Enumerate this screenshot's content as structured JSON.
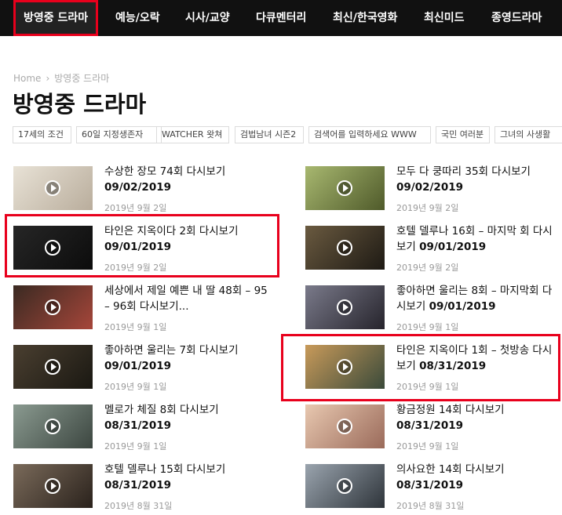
{
  "nav": {
    "items": [
      {
        "label": "방영중 드라마",
        "active": true
      },
      {
        "label": "예능/오락"
      },
      {
        "label": "시사/교양"
      },
      {
        "label": "다큐멘터리"
      },
      {
        "label": "최신/한국영화"
      },
      {
        "label": "최신미드"
      },
      {
        "label": "종영드라마"
      }
    ]
  },
  "breadcrumb": {
    "home": "Home",
    "separator": "›",
    "current": "방영중 드라마"
  },
  "page_title": "방영중 드라마",
  "tags": [
    "17세의 조건",
    "60일 지정생존자",
    "WATCHER 왓쳐",
    "검법남녀 시즌2",
    "검색어를 입력하세요 WWW",
    "국민 여러분",
    "그녀의 사생활"
  ],
  "colors": {
    "nav_bg": "#111111",
    "highlight": "#e8001c",
    "meta": "#999999"
  },
  "posts": [
    {
      "title": "수상한 장모 74회 다시보기",
      "date": "09/02/2019",
      "meta": "2019년 9월 2일",
      "thumb": "#c9c2b8",
      "icon": "play-icon"
    },
    {
      "title": "모두 다 쿵따리 35회 다시보기",
      "date": "09/02/2019",
      "meta": "2019년 9월 2일",
      "thumb": "#7d8a52",
      "icon": "play-icon"
    },
    {
      "title": "타인은 지옥이다 2회 다시보기",
      "date": "09/01/2019",
      "meta": "2019년 9월 2일",
      "thumb": "#141414",
      "icon": "play-icon"
    },
    {
      "title": "호텔 델루나 16회 – 마지막 회 다시보기",
      "date": "09/01/2019",
      "meta": "2019년 9월 2일",
      "thumb": "#3a3024",
      "icon": "play-icon"
    },
    {
      "title": "세상에서 제일 예쁜 내 딸 48회 – 95 – 96회 다시보기...",
      "date": "",
      "meta": "2019년 9월 1일",
      "thumb": "#8a3a2a",
      "icon": "play-icon"
    },
    {
      "title": "좋아하면 울리는 8회 – 마지막회 다시보기",
      "date": "09/01/2019",
      "meta": "2019년 9월 1일",
      "thumb": "#4b4a56",
      "icon": "play-icon"
    },
    {
      "title": "좋아하면 울리는 7회 다시보기",
      "date": "09/01/2019",
      "meta": "2019년 9월 1일",
      "thumb": "#2e2a24",
      "icon": "play-icon"
    },
    {
      "title": "타인은 지옥이다 1회 – 첫방송 다시보기",
      "date": "08/31/2019",
      "meta": "2019년 9월 1일",
      "thumb": "#6f5a3c",
      "icon": "play-icon"
    },
    {
      "title": "멜로가 체질 8회 다시보기",
      "date": "08/31/2019",
      "meta": "2019년 9월 1일",
      "thumb": "#5e6a62",
      "icon": "play-icon"
    },
    {
      "title": "황금정원 14회 다시보기",
      "date": "08/31/2019",
      "meta": "2019년 9월 1일",
      "thumb": "#c8a48e",
      "icon": "play-icon"
    },
    {
      "title": "호텔 델루나 15회 다시보기",
      "date": "08/31/2019",
      "meta": "2019년 8월 31일",
      "thumb": "#4a3e36",
      "icon": "play-icon"
    },
    {
      "title": "의사요한 14회 다시보기",
      "date": "08/31/2019",
      "meta": "2019년 8월 31일",
      "thumb": "#56606a",
      "icon": "play-icon"
    }
  ]
}
